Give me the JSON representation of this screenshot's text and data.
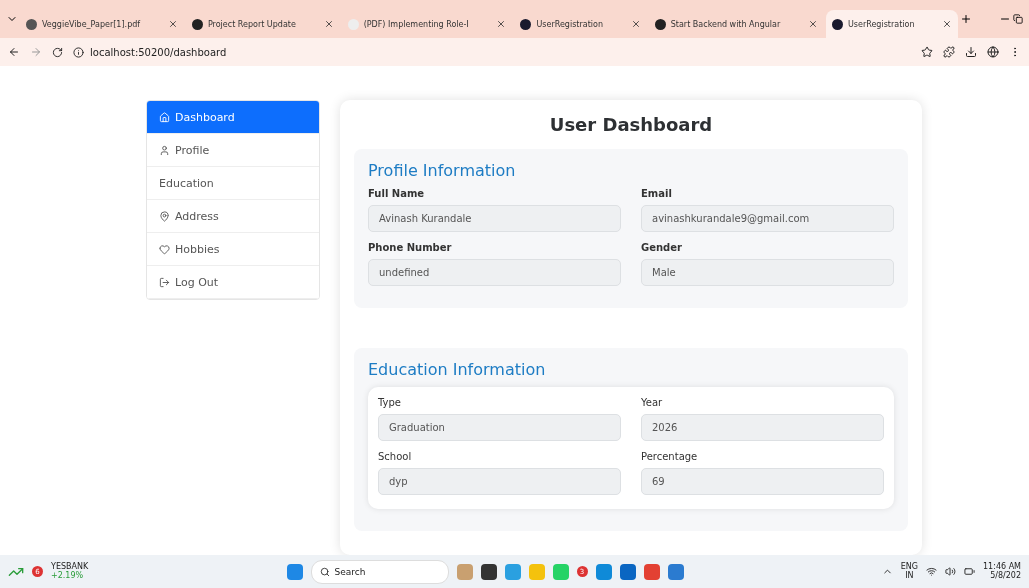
{
  "browser": {
    "tabs": [
      {
        "title": "VeggieVibe_Paper[1].pdf",
        "kind": "globe",
        "selected": false
      },
      {
        "title": "Project Report Update",
        "kind": "dark",
        "selected": false
      },
      {
        "title": "(PDF) Implementing Role-I",
        "kind": "rg",
        "selected": false
      },
      {
        "title": "UserRegistration",
        "kind": "angular",
        "selected": false
      },
      {
        "title": "Start Backend with Angular",
        "kind": "dark",
        "selected": false
      },
      {
        "title": "UserRegistration",
        "kind": "angular",
        "selected": true
      }
    ],
    "url": "localhost:50200/dashboard"
  },
  "sidebar": {
    "items": [
      {
        "label": "Dashboard",
        "kind": "home",
        "selected": true
      },
      {
        "label": "Profile",
        "kind": "user",
        "selected": false
      },
      {
        "label": "Education",
        "kind": "plain",
        "selected": false
      },
      {
        "label": "Address",
        "kind": "pin",
        "selected": false
      },
      {
        "label": "Hobbies",
        "kind": "heart",
        "selected": false
      },
      {
        "label": "Log Out",
        "kind": "logout",
        "selected": false
      }
    ]
  },
  "dashboard": {
    "title": "User Dashboard",
    "profile": {
      "heading": "Profile Information",
      "fields": [
        {
          "label": "Full Name",
          "value": "Avinash Kurandale"
        },
        {
          "label": "Email",
          "value": "avinashkurandale9@gmail.com"
        },
        {
          "label": "Phone Number",
          "value": "undefined"
        },
        {
          "label": "Gender",
          "value": "Male"
        }
      ]
    },
    "education": {
      "heading": "Education Information",
      "fields": [
        {
          "label": "Type",
          "value": "Graduation"
        },
        {
          "label": "Year",
          "value": "2026"
        },
        {
          "label": "School",
          "value": "dyp"
        },
        {
          "label": "Percentage",
          "value": "69"
        }
      ]
    }
  },
  "taskbar": {
    "stock": {
      "name": "YESBANK",
      "change": "+2.19%",
      "badge": "6"
    },
    "search": "Search",
    "chat_badge": "3",
    "language": "ENG",
    "region": "IN",
    "time": "11:46 AM",
    "date": "5/8/202"
  }
}
